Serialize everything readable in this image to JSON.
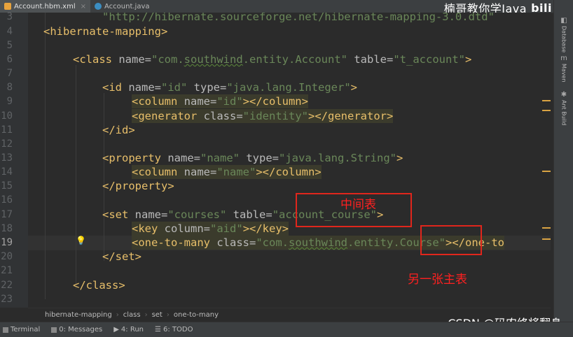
{
  "tabs": [
    {
      "label": "Account.hbm.xml",
      "active": true
    },
    {
      "label": "Account.java",
      "active": false
    }
  ],
  "watermark_top": "楠哥教你学Java",
  "gutter": {
    "lines": [
      "3",
      "4",
      "5",
      "6",
      "7",
      "8",
      "9",
      "10",
      "11",
      "12",
      "13",
      "14",
      "15",
      "16",
      "17",
      "18",
      "19",
      "20",
      "21",
      "22",
      "23"
    ],
    "current_line": "19"
  },
  "code": {
    "l3": "\"http://hibernate.sourceforge.net/hibernate-mapping-3.0.dtd\"",
    "l4_open": "<hibernate-mapping>",
    "l6": {
      "open": "<class ",
      "a1": "name",
      "eq1": "=",
      "v1a": "\"com.",
      "v1b": "southwind",
      "v1c": ".entity.Account\"",
      "a2": "table",
      "v2": "\"t_account\"",
      "close": ">"
    },
    "l8": {
      "open": "<id ",
      "a1": "name",
      "v1": "\"id\"",
      "a2": "type",
      "v2": "\"java.lang.Integer\"",
      "close": ">"
    },
    "l9": {
      "open": "<column ",
      "a1": "name",
      "v1": "\"id\"",
      "close": "></column>"
    },
    "l10": {
      "open": "<generator ",
      "a1": "class",
      "v1": "\"identity\"",
      "close": "></generator>"
    },
    "l11": "</id>",
    "l13": {
      "open": "<property ",
      "a1": "name",
      "v1": "\"name\"",
      "a2": "type",
      "v2": "\"java.lang.String\"",
      "close": ">"
    },
    "l14": {
      "open": "<column ",
      "a1": "name",
      "v1": "\"name\"",
      "close": "></column>"
    },
    "l15": "</property>",
    "l17": {
      "open": "<set ",
      "a1": "name",
      "v1": "\"courses\"",
      "a2": "table",
      "v2": "\"account_course\"",
      "close": ">"
    },
    "l18": {
      "open": "<key ",
      "a1": "column",
      "v1": "\"aid\"",
      "close": "></key>"
    },
    "l19": {
      "open": "<one-to-many ",
      "a1": "class",
      "v1a": "\"com.",
      "v1b": "southwind",
      "v1c": ".entity.Course\"",
      "close": "></one-to"
    },
    "l20": "</set>",
    "l22": "</class>"
  },
  "annotations": {
    "middle_table": "中间表",
    "other_main_table": "另一张主表"
  },
  "right_tools": [
    "Database",
    "Maven",
    "Ant Build"
  ],
  "breadcrumb": [
    "hibernate-mapping",
    "class",
    "set",
    "one-to-many"
  ],
  "bottom_tools": [
    {
      "label": "Terminal"
    },
    {
      "label": "0: Messages"
    },
    {
      "label": "4: Run"
    },
    {
      "label": "6: TODO"
    }
  ],
  "watermark_bottom": "CSDN @码农终将翻身",
  "colors": {
    "tag": "#e8bf6a",
    "attr": "#bababa",
    "value": "#6a8759",
    "annotation": "#ff2020"
  }
}
